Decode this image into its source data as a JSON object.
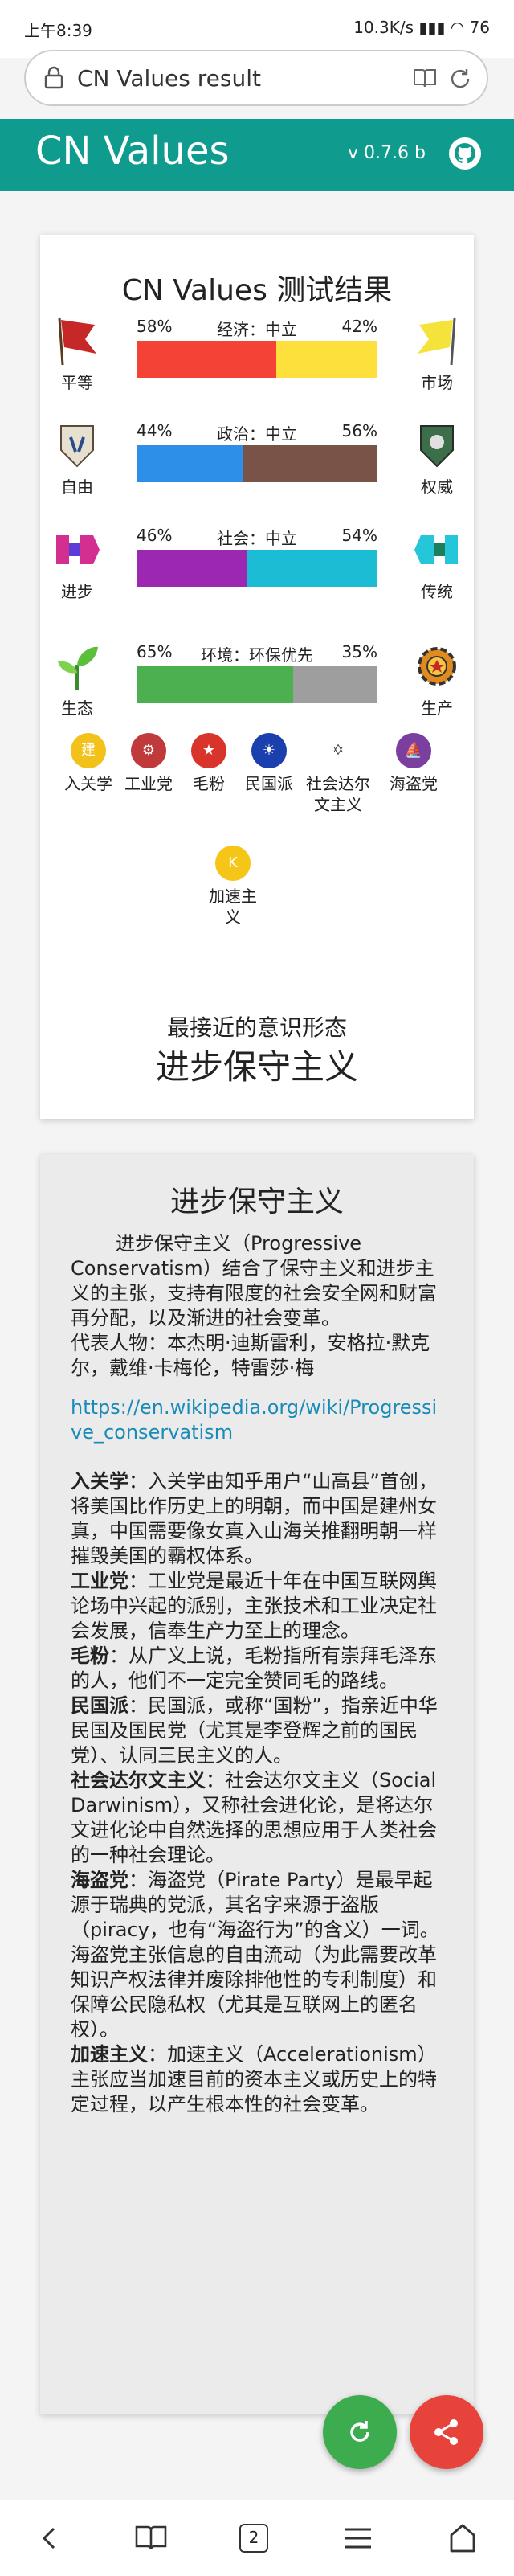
{
  "status_bar": {
    "time": "上午8:39",
    "net_speed": "10.3K/s",
    "battery": "76"
  },
  "browser": {
    "page_title": "CN Values result"
  },
  "app": {
    "name": "CN Values",
    "version": "v 0.7.6 b",
    "accent_color": "#0f9b8e"
  },
  "result": {
    "title": "CN Values 测试结果",
    "axes": [
      {
        "left_label": "平等",
        "right_label": "市场",
        "left_pct": "58%",
        "right_pct": "42%",
        "left_value": 58,
        "right_value": 42,
        "center": "经济：中立",
        "left_color": "#f44336",
        "right_color": "#fde03b",
        "left_icon": "red-flag-icon",
        "right_icon": "yellow-flag-icon"
      },
      {
        "left_label": "自由",
        "right_label": "权威",
        "left_pct": "44%",
        "right_pct": "56%",
        "left_value": 44,
        "right_value": 56,
        "center": "政治：中立",
        "left_color": "#2e8fe8",
        "right_color": "#7a5348",
        "left_icon": "wings-of-freedom-icon",
        "right_icon": "authority-emblem-icon"
      },
      {
        "left_label": "进步",
        "right_label": "传统",
        "left_pct": "46%",
        "right_pct": "54%",
        "left_value": 46,
        "right_value": 54,
        "center": "社会：中立",
        "left_color": "#9c27b0",
        "right_color": "#1bbcd4",
        "left_icon": "progress-arrow-icon",
        "right_icon": "tradition-arrow-icon"
      },
      {
        "left_label": "生态",
        "right_label": "生产",
        "left_pct": "65%",
        "right_pct": "35%",
        "left_value": 65,
        "right_value": 35,
        "center": "环境：环保优先",
        "left_color": "#4caf50",
        "right_color": "#9e9e9e",
        "left_icon": "sprout-icon",
        "right_icon": "gear-icon"
      }
    ],
    "ideologies": [
      {
        "label": "入关学",
        "icon": "jianzhou-badge-icon",
        "glyph": "建"
      },
      {
        "label": "工业党",
        "icon": "industry-globe-icon",
        "glyph": "⚙"
      },
      {
        "label": "毛粉",
        "icon": "mao-portrait-icon",
        "glyph": "★"
      },
      {
        "label": "民国派",
        "icon": "blue-sky-white-sun-icon",
        "glyph": "☀"
      },
      {
        "label": "社会达尔文主义",
        "icon": "darwin-star-icon",
        "glyph": "✡"
      },
      {
        "label": "海盗党",
        "icon": "pirate-sail-icon",
        "glyph": "⛵"
      },
      {
        "label": "加速主义",
        "icon": "accelerationism-icon",
        "glyph": "K"
      }
    ],
    "closest_label": "最接近的意识形态",
    "closest_value": "进步保守主义"
  },
  "detail": {
    "heading": "进步保守主义",
    "intro": "进步保守主义（Progressive Conservatism）结合了保守主义和进步主义的主张，支持有限度的社会安全网和财富再分配，以及渐进的社会变革。",
    "representatives": "代表人物：本杰明·迪斯雷利，安格拉·默克尔，戴维·卡梅伦，特雷莎·梅",
    "link": "https://en.wikipedia.org/wiki/Progressive_conservatism",
    "entries": [
      {
        "term": "入关学",
        "text": "：入关学由知乎用户“山高县”首创，将美国比作历史上的明朝，而中国是建州女真，中国需要像女真入山海关推翻明朝一样摧毁美国的霸权体系。"
      },
      {
        "term": "工业党",
        "text": "：工业党是最近十年在中国互联网舆论场中兴起的派别，主张技术和工业决定社会发展，信奉生产力至上的理念。"
      },
      {
        "term": "毛粉",
        "text": "：从广义上说，毛粉指所有崇拜毛泽东的人，他们不一定完全赞同毛的路线。"
      },
      {
        "term": "民国派",
        "text": "：民国派，或称“国粉”，指亲近中华民国及国民党（尤其是李登辉之前的国民党）、认同三民主义的人。"
      },
      {
        "term": "社会达尔文主义",
        "text": "：社会达尔文主义（Social Darwinism），又称社会进化论，是将达尔文进化论中自然选择的思想应用于人类社会的一种社会理论。"
      },
      {
        "term": "海盗党",
        "text": "：海盗党（Pirate Party）是最早起源于瑞典的党派，其名字来源于盗版（piracy，也有“海盗行为”的含义）一词。海盗党主张信息的自由流动（为此需要改革知识产权法律并废除排他性的专利制度）和保障公民隐私权（尤其是互联网上的匿名权）。"
      },
      {
        "term": "加速主义",
        "text": "：加速主义（Accelerationism）主张应当加速目前的资本主义或历史上的特定过程，以产生根本性的社会变革。"
      }
    ]
  },
  "navbar": {
    "tab_count": "2"
  }
}
